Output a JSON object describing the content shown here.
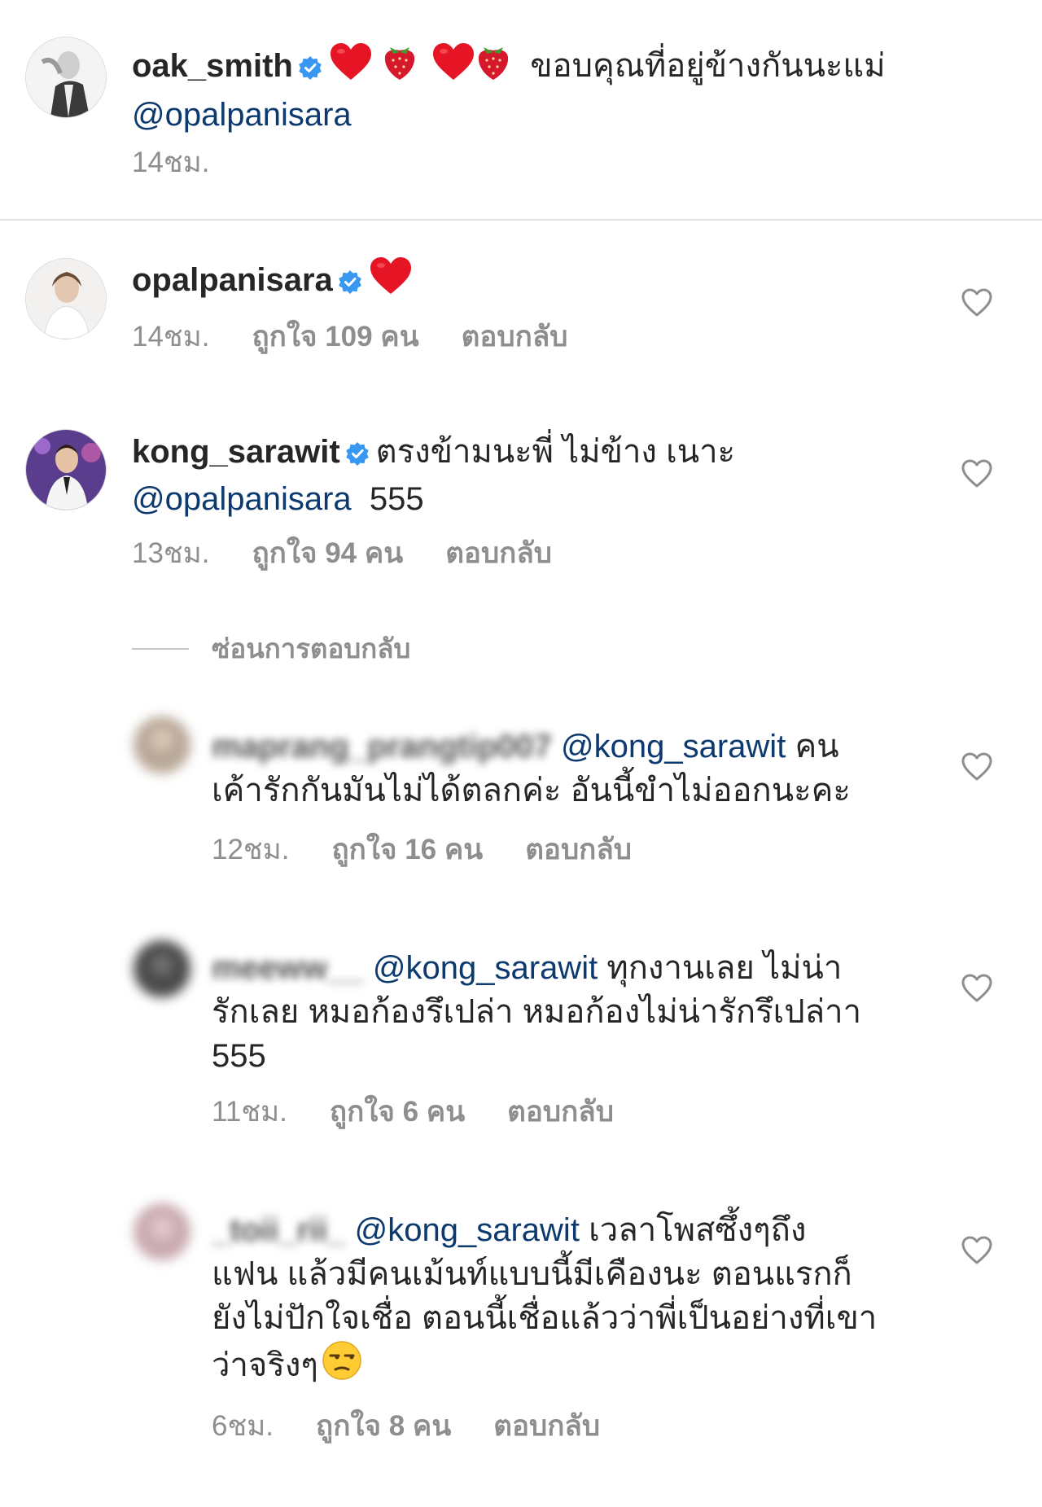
{
  "caption": {
    "username": "oak_smith",
    "text": "ขอบคุณที่อยู่ข้างกันนะแม่",
    "mention": "@opalpanisara",
    "time": "14ชม."
  },
  "comments": [
    {
      "username": "opalpanisara",
      "time": "14ชม.",
      "likes": "ถูกใจ 109 คน",
      "reply": "ตอบกลับ"
    },
    {
      "username": "kong_sarawit",
      "text": "ตรงข้ามนะพี่ ไม่ข้าง เนาะ",
      "mention": "@opalpanisara",
      "text_after": "555",
      "time": "13ชม.",
      "likes": "ถูกใจ 94 คน",
      "reply": "ตอบกลับ"
    }
  ],
  "hide_replies": "ซ่อนการตอบกลับ",
  "replies": [
    {
      "username": "maprang_prangtip007",
      "mention": "@kong_sarawit",
      "line1_rest": "คน",
      "line2": "เค้ารักกันมันไม่ได้ตลกค่ะ อันนี้ขำไม่ออกนะคะ",
      "time": "12ชม.",
      "likes": "ถูกใจ 16 คน",
      "reply": "ตอบกลับ"
    },
    {
      "username": "meeww__",
      "mention": "@kong_sarawit",
      "line1_rest": "ทุกงานเลย ไม่น่า",
      "line2": "รักเลย หมอก้องรึเปล่า หมอก้องไม่น่ารักรึเปล่าา",
      "line3": "555",
      "time": "11ชม.",
      "likes": "ถูกใจ 6 คน",
      "reply": "ตอบกลับ"
    },
    {
      "username": "_toii_rii_",
      "mention": "@kong_sarawit",
      "line1_rest": "เวลาโพสซึ้งๆถึง",
      "line2": "แฟน แล้วมีคนเม้นท์แบบนี้มีเคืองนะ ตอนแรกก็",
      "line3": "ยังไม่ปักใจเชื่อ ตอนนี้เชื่อแล้วว่าพี่เป็นอย่างที่เขา",
      "line4": "ว่าจริงๆ",
      "time": "6ชม.",
      "likes": "ถูกใจ 8 คน",
      "reply": "ตอบกลับ"
    }
  ],
  "icons": {
    "verified": "verified-badge-icon",
    "heart_emoji": "red-heart-emoji",
    "strawberry_emoji": "strawberry-emoji",
    "unamused_emoji": "unamused-face-emoji",
    "like": "heart-outline-icon"
  },
  "colors": {
    "text": "#262626",
    "secondary": "#8e8e8e",
    "mention": "#0d3a6e",
    "verified": "#3897f0",
    "divider": "#e3e3e3"
  }
}
